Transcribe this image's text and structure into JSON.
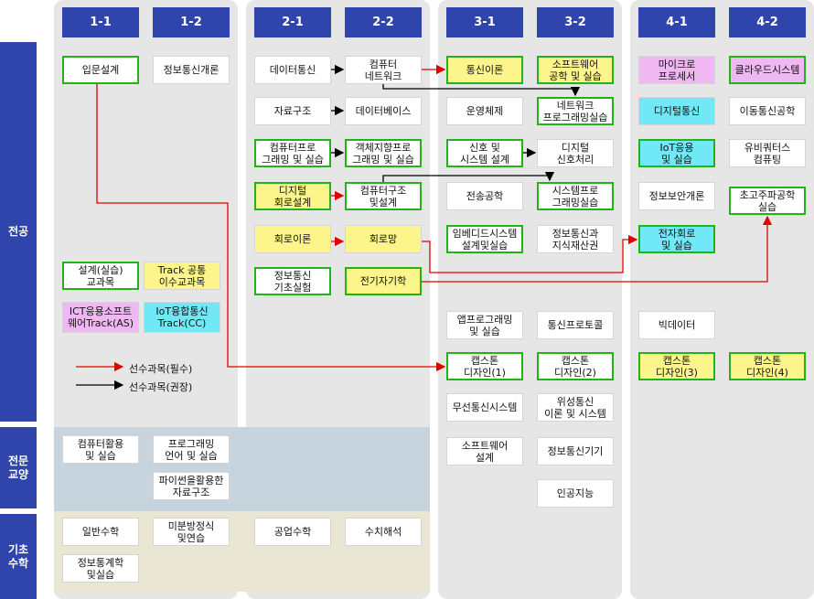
{
  "sections": {
    "major": "전공",
    "liberal": "전문\n교양",
    "basic": "기초\n수학"
  },
  "semesters": [
    "1-1",
    "1-2",
    "2-1",
    "2-2",
    "3-1",
    "3-2",
    "4-1",
    "4-2"
  ],
  "courses": {
    "c11_intro": "입문설계",
    "c12_info": "정보통신개론",
    "c21_datacomm": "데이터통신",
    "c22_network": "컴퓨터\n네트워크",
    "c31_commtheory": "통신이론",
    "c32_swe": "소프트웨어\n공학 및 실습",
    "c41_micro": "마이크로\n프로세서",
    "c42_cloud": "클라우드시스템",
    "c21_datastruct": "자료구조",
    "c22_db": "데이터베이스",
    "c31_os": "운영체제",
    "c32_netprog": "네트워크\n프로그래밍실습",
    "c41_digicomm": "디지털통신",
    "c42_mobile": "이동통신공학",
    "c21_prog": "컴퓨터프로\n그래밍 및 실습",
    "c22_oop": "객체지향프로\n그래밍 및 실습",
    "c31_signals": "신호 및\n시스템 설계",
    "c32_dsp": "디지털\n신호처리",
    "c41_iot": "IoT응용\n및 실습",
    "c42_ubiq": "유비쿼터스\n컴퓨팅",
    "c21_digital": "디지털\n회로설계",
    "c22_arch": "컴퓨터구조\n및설계",
    "c31_trans": "전송공학",
    "c32_sysprog": "시스템프로\n그래밍실습",
    "c41_security": "정보보안개론",
    "c42_hf": "초고주파공학\n실습",
    "c21_circuit": "회로이론",
    "c22_network_circ": "회로망",
    "c31_embedded": "임베디드시스템\n설계및실습",
    "c32_ip": "정보통신과\n지식재산권",
    "c41_electronic": "전자회로\n및 실습",
    "c21_lab": "정보통신\n기초실험",
    "c22_em": "전기자기학",
    "c31_app": "앱프로그래밍\n및 실습",
    "c32_protocol": "통신프로토콜",
    "c41_bigdata": "빅데이터",
    "c31_cap1": "캡스톤\n디자인(1)",
    "c32_cap2": "캡스톤\n디자인(2)",
    "c41_cap3": "캡스톤\n디자인(3)",
    "c42_cap4": "캡스톤\n디자인(4)",
    "c31_wireless": "무선통신시스템",
    "c32_satellite": "위성통신\n이론 및 시스템",
    "c31_swdesign": "소프트웨어\n설계",
    "c32_device": "정보통신기기",
    "c32_ai": "인공지능",
    "c11_design": "설계(실습)\n교과목",
    "c12_track": "Track 공통\n이수교과목",
    "c11_ict": "ICT응용소프트\n웨어Track(AS)",
    "c12_iot": "IoT융합통신\nTrack(CC)",
    "l11_comp": "컴퓨터활용\n및 실습",
    "l12_lang": "프로그래밍\n언어 및 실습",
    "l12_python": "파이썬을활용한\n자료구조",
    "b11_math": "일반수학",
    "b12_diffeq": "미분방정식\n및연습",
    "b21_engmath": "공업수학",
    "b22_numeric": "수치해석",
    "b11_stats": "정보통계학\n및실습"
  },
  "legend": {
    "required": "선수과목(필수)",
    "recommended": "선수과목(권장)"
  },
  "colors": {
    "navy": "#2f45ac",
    "green": "#23b317",
    "red": "#e00000",
    "yellow": "#fcf58c",
    "pink": "#f0b8f2",
    "cyan": "#70e8f6"
  }
}
